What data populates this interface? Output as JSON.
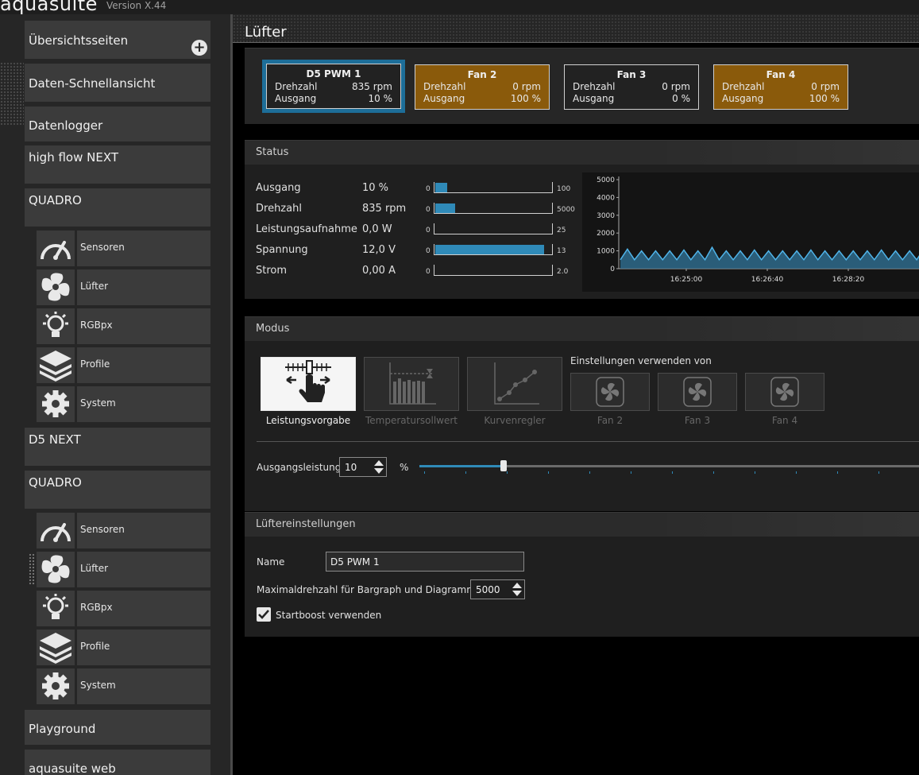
{
  "app": {
    "title": "aquasuite",
    "version": "Version X.44"
  },
  "sidebar": {
    "overview": "Übersichtsseiten",
    "quickview": "Daten-Schnellansicht",
    "datalogger": "Datenlogger",
    "highflow": "high flow NEXT",
    "quadro1": "QUADRO",
    "d5next": "D5 NEXT",
    "quadro2": "QUADRO",
    "playground": "Playground",
    "web": "aquasuite web",
    "sub": {
      "sensors": "Sensoren",
      "fans": "Lüfter",
      "rgbpx": "RGBpx",
      "profiles": "Profile",
      "system": "System"
    }
  },
  "page": {
    "title": "Lüfter"
  },
  "fans": [
    {
      "name": "D5 PWM 1",
      "speed_label": "Drehzahl",
      "speed": "835 rpm",
      "out_label": "Ausgang",
      "out": "10 %"
    },
    {
      "name": "Fan 2",
      "speed_label": "Drehzahl",
      "speed": "0 rpm",
      "out_label": "Ausgang",
      "out": "100 %"
    },
    {
      "name": "Fan 3",
      "speed_label": "Drehzahl",
      "speed": "0 rpm",
      "out_label": "Ausgang",
      "out": "0 %"
    },
    {
      "name": "Fan 4",
      "speed_label": "Drehzahl",
      "speed": "0 rpm",
      "out_label": "Ausgang",
      "out": "100 %"
    }
  ],
  "colors": {
    "accent": "#2f8ab8",
    "selected": "#1d6e99",
    "alarm": "#8a5a0b"
  },
  "status": {
    "title": "Status",
    "rows": [
      {
        "label": "Ausgang",
        "value": "10 %",
        "min": "0",
        "max": "100",
        "fill": 0.1
      },
      {
        "label": "Drehzahl",
        "value": "835 rpm",
        "min": "0",
        "max": "5000",
        "fill": 0.167
      },
      {
        "label": "Leistungsaufnahme",
        "value": "0,0 W",
        "min": "0",
        "max": "25",
        "fill": 0
      },
      {
        "label": "Spannung",
        "value": "12,0 V",
        "min": "0",
        "max": "13",
        "fill": 0.923
      },
      {
        "label": "Strom",
        "value": "0,00 A",
        "min": "0",
        "max": "2.0",
        "fill": 0
      }
    ]
  },
  "chart_data": {
    "type": "area",
    "y_ticks": [
      "5000",
      "4000",
      "3000",
      "2000",
      "1000",
      "0"
    ],
    "ylim": [
      0,
      5000
    ],
    "x_ticks": [
      "16:25:00",
      "16:26:40",
      "16:28:20"
    ],
    "series": [
      {
        "values": [
          500,
          1100,
          500,
          1000,
          500,
          1000,
          500,
          1000,
          500,
          1050,
          500,
          1000,
          500,
          1200,
          500,
          1000,
          500,
          1000,
          500,
          1050,
          500,
          1000,
          500,
          1000,
          500,
          1000,
          500,
          1050,
          500,
          1000,
          500,
          1000,
          500,
          1000,
          500,
          1000,
          500,
          1050,
          500,
          1000,
          500,
          1000,
          500,
          1100
        ]
      }
    ]
  },
  "mode": {
    "title": "Modus",
    "buttons": [
      "Leistungsvorgabe",
      "Temperatursollwert",
      "Kurvenregler"
    ],
    "use_settings_label": "Einstellungen verwenden von",
    "sources": [
      "Fan 2",
      "Fan 3",
      "Fan 4"
    ],
    "output_label": "Ausgangsleistung",
    "output_value": "10",
    "output_unit": "%",
    "slider_fraction": 0.1
  },
  "settings": {
    "title": "Lüftereinstellungen",
    "name_label": "Name",
    "name_value": "D5 PWM 1",
    "maxrpm_label": "Maximaldrehzahl für Bargraph und Diagramm",
    "maxrpm_value": "5000",
    "startboost_label": "Startboost verwenden"
  }
}
